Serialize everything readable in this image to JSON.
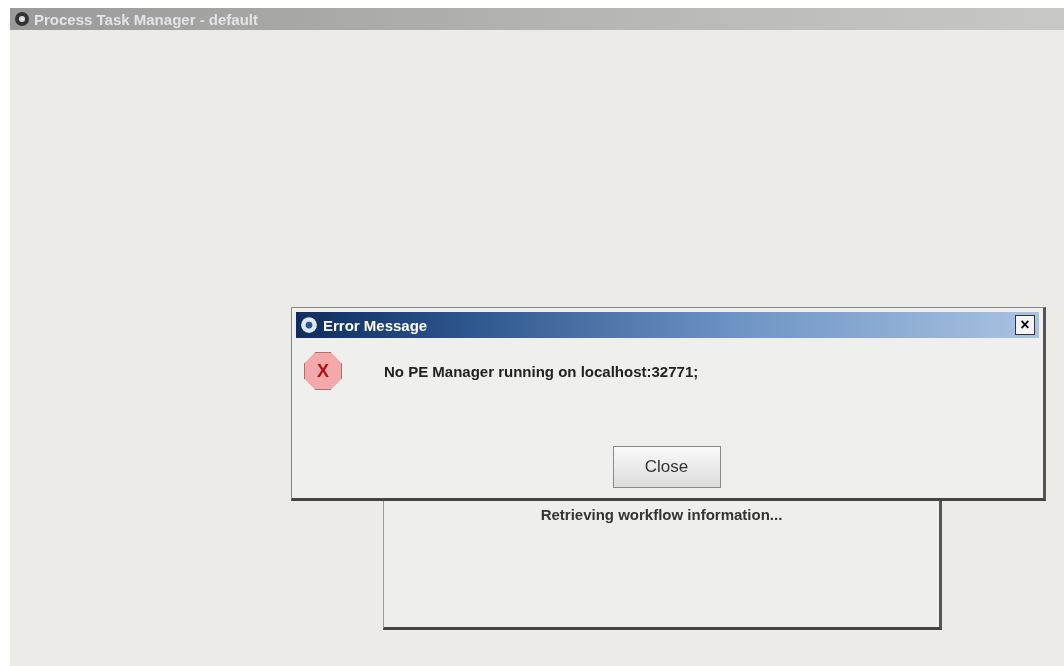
{
  "window": {
    "title": "Process Task Manager - default"
  },
  "progress_dialog": {
    "message": "Retrieving workflow information..."
  },
  "error_dialog": {
    "title": "Error Message",
    "close_glyph": "×",
    "icon_glyph": "X",
    "message": "No PE Manager running on localhost:32771;",
    "button": "Close"
  }
}
